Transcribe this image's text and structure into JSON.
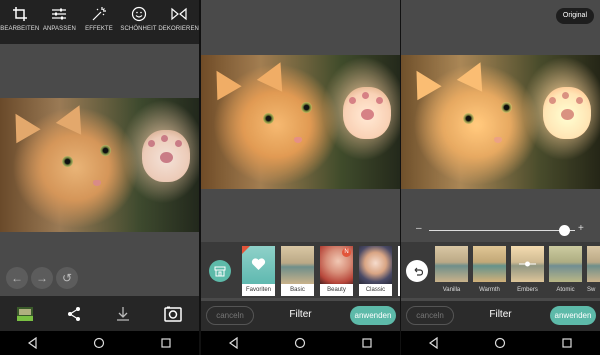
{
  "screen1": {
    "tools": [
      {
        "label": "BEARBEITEN",
        "icon": "crop-icon"
      },
      {
        "label": "ANPASSEN",
        "icon": "sliders-icon"
      },
      {
        "label": "EFFEKTE",
        "icon": "sparkle-icon"
      },
      {
        "label": "SCHÖNHEIT",
        "icon": "smile-icon"
      },
      {
        "label": "DEKORIEREN",
        "icon": "bowtie-icon"
      }
    ],
    "undo_glyph": "←",
    "redo_glyph": "→",
    "history_glyph": "↺"
  },
  "screen2": {
    "filters": [
      {
        "name": "Favoriten"
      },
      {
        "name": "Basic"
      },
      {
        "name": "Beauty"
      },
      {
        "name": "Classic"
      }
    ],
    "badge_new": "N",
    "cancel_label": "canceln",
    "title": "Filter",
    "apply_label": "anwenden"
  },
  "screen3": {
    "original_label": "Original",
    "slider_minus": "–",
    "slider_plus": "+",
    "slider_value": 0.93,
    "filters": [
      {
        "name": "Vanilla"
      },
      {
        "name": "Warmth"
      },
      {
        "name": "Embers"
      },
      {
        "name": "Atomic"
      },
      {
        "name": "Sw"
      }
    ],
    "cancel_label": "canceln",
    "title": "Filter",
    "apply_label": "anwenden"
  },
  "colors": {
    "accent": "#5dbaa9",
    "background": "#4a4a4a",
    "toolbar": "#222222"
  }
}
